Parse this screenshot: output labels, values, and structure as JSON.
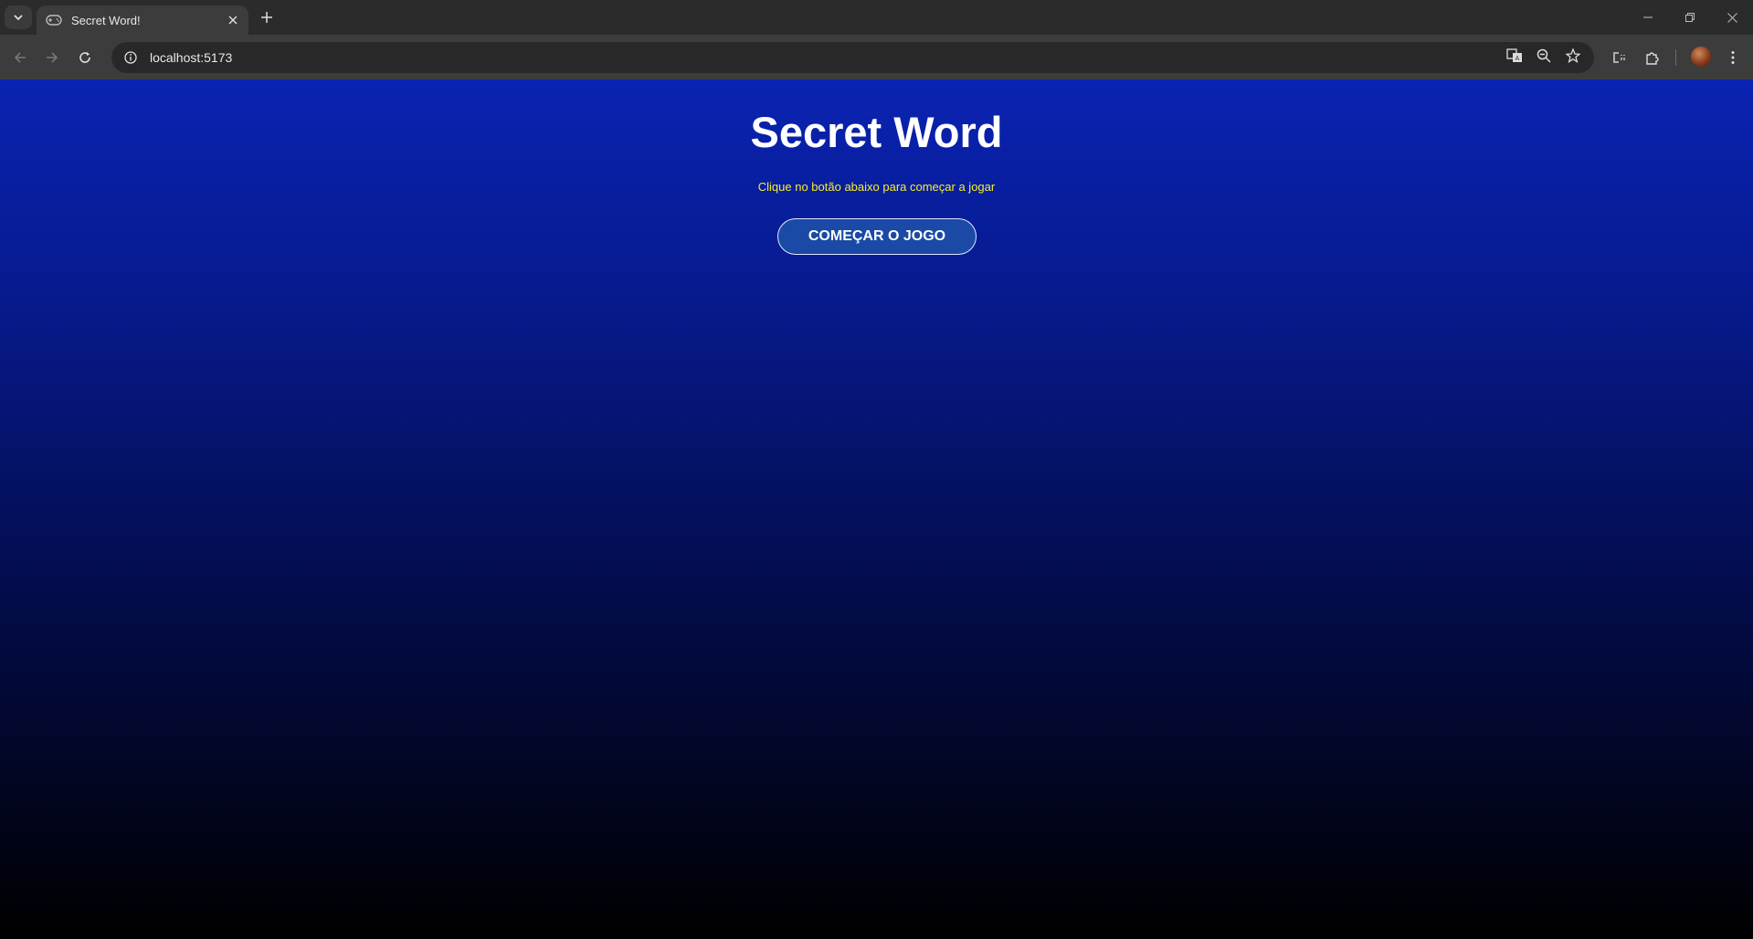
{
  "browser": {
    "tab_title": "Secret Word!",
    "url": "localhost:5173"
  },
  "page": {
    "title": "Secret Word",
    "subtitle": "Clique no botão abaixo para começar a jogar",
    "start_button_label": "COMEÇAR O JOGO"
  },
  "colors": {
    "gradient_top": "#0a23b2",
    "gradient_bottom": "#000000",
    "subtitle": "#f5ee2a",
    "button_bg": "#1a4aa5"
  }
}
